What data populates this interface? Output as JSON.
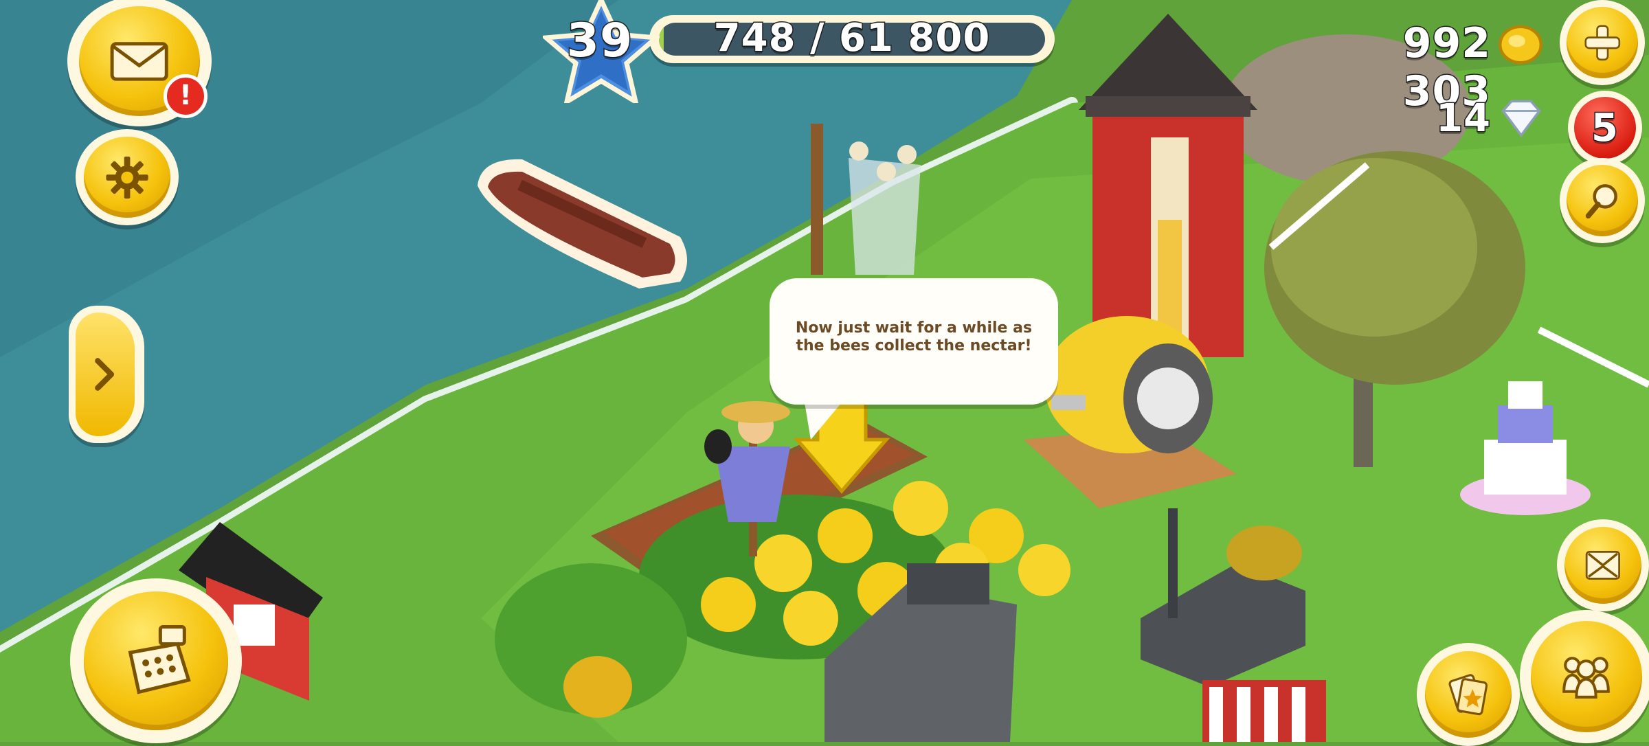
{
  "player": {
    "level": "39",
    "xp_text": "748 / 61 800",
    "xp_fraction": 0.0121
  },
  "currency": {
    "coins": "992 303",
    "gems": "14"
  },
  "badges": {
    "mail_alert": "!",
    "notification_count": "5"
  },
  "tutorial": {
    "message": "Now just wait for a while as the bees collect the nectar!"
  },
  "icons": {
    "mail": "envelope-icon",
    "settings": "gear-icon",
    "expand": "chevron-right-icon",
    "shop": "cash-register-icon",
    "add_coins": "plus-icon",
    "search": "magnifier-icon",
    "edit_mode": "expand-arrows-icon",
    "friends": "people-icon",
    "cards": "star-card-icon"
  },
  "colors": {
    "water": "#3e8e9a",
    "grass": "#68b43c",
    "hud_yellow": "#f5c20c",
    "badge_red": "#e52a1f"
  }
}
